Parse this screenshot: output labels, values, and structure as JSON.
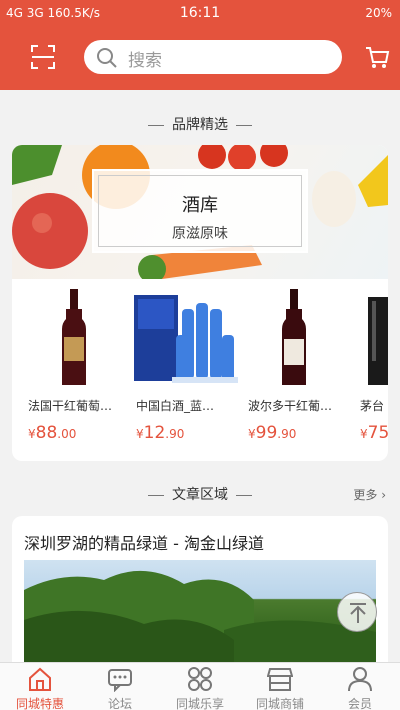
{
  "status_bar": {
    "network": "4G 3G 160.5K/s",
    "time": "16:11",
    "battery": "20%"
  },
  "header": {
    "search_placeholder": "搜索",
    "scan_icon": "scan-icon",
    "cart_icon": "cart-icon"
  },
  "brand_section": {
    "title": "品牌精选",
    "banner": {
      "title": "酒库",
      "subtitle": "原滋原味"
    },
    "products": [
      {
        "name": "法国干红葡萄…",
        "currency": "¥",
        "price_int": "88",
        "price_dec": ".00"
      },
      {
        "name": "中国白酒_蓝…",
        "currency": "¥",
        "price_int": "12",
        "price_dec": ".90"
      },
      {
        "name": "波尔多干红葡…",
        "currency": "¥",
        "price_int": "99",
        "price_dec": ".90"
      },
      {
        "name": "茅台",
        "currency": "¥",
        "price_int": "75",
        "price_dec": ""
      }
    ]
  },
  "article_section": {
    "title": "文章区域",
    "more": "更多",
    "article": {
      "title": "深圳罗湖的精品绿道 - 淘金山绿道"
    }
  },
  "tabbar": {
    "tabs": [
      {
        "label": "同城特惠",
        "active": true
      },
      {
        "label": "论坛",
        "active": false
      },
      {
        "label": "同城乐享",
        "active": false
      },
      {
        "label": "同城商铺",
        "active": false
      },
      {
        "label": "会员",
        "active": false
      }
    ]
  },
  "colors": {
    "accent": "#e4533d",
    "background": "#f2f2f2"
  }
}
